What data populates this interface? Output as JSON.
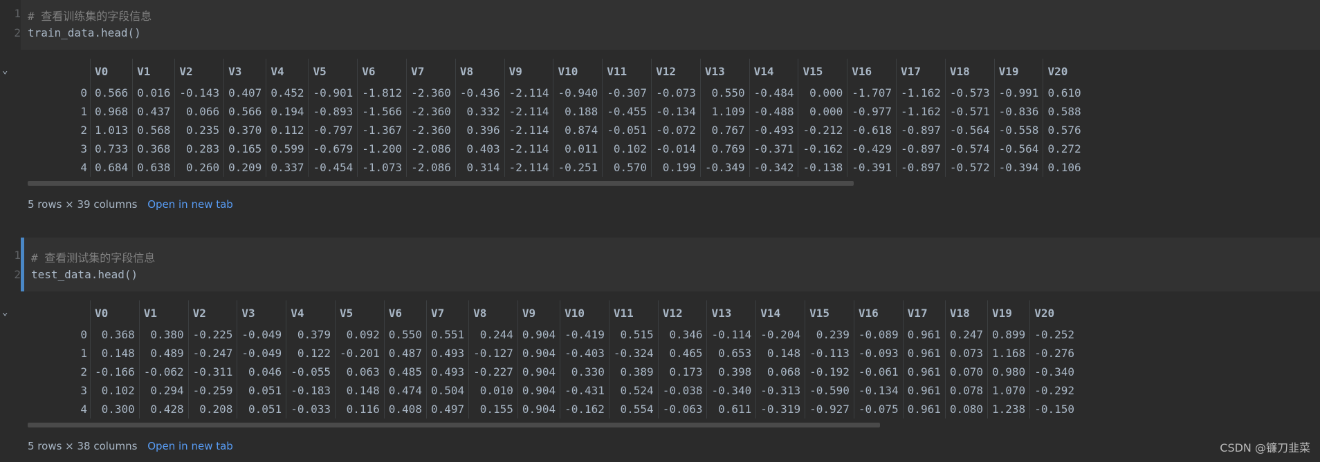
{
  "cells": [
    {
      "lines": [
        "# 查看训练集的字段信息",
        "train_data.head()"
      ],
      "footer": "5 rows × 39 columns",
      "link": "Open in new tab",
      "columns": [
        "V0",
        "V1",
        "V2",
        "V3",
        "V4",
        "V5",
        "V6",
        "V7",
        "V8",
        "V9",
        "V10",
        "V11",
        "V12",
        "V13",
        "V14",
        "V15",
        "V16",
        "V17",
        "V18",
        "V19",
        "V20"
      ],
      "rows": [
        {
          "idx": "0",
          "vals": [
            "0.566",
            "0.016",
            "-0.143",
            "0.407",
            "0.452",
            "-0.901",
            "-1.812",
            "-2.360",
            "-0.436",
            "-2.114",
            "-0.940",
            "-0.307",
            "-0.073",
            "0.550",
            "-0.484",
            "0.000",
            "-1.707",
            "-1.162",
            "-0.573",
            "-0.991",
            "0.610"
          ]
        },
        {
          "idx": "1",
          "vals": [
            "0.968",
            "0.437",
            "0.066",
            "0.566",
            "0.194",
            "-0.893",
            "-1.566",
            "-2.360",
            "0.332",
            "-2.114",
            "0.188",
            "-0.455",
            "-0.134",
            "1.109",
            "-0.488",
            "0.000",
            "-0.977",
            "-1.162",
            "-0.571",
            "-0.836",
            "0.588"
          ]
        },
        {
          "idx": "2",
          "vals": [
            "1.013",
            "0.568",
            "0.235",
            "0.370",
            "0.112",
            "-0.797",
            "-1.367",
            "-2.360",
            "0.396",
            "-2.114",
            "0.874",
            "-0.051",
            "-0.072",
            "0.767",
            "-0.493",
            "-0.212",
            "-0.618",
            "-0.897",
            "-0.564",
            "-0.558",
            "0.576"
          ]
        },
        {
          "idx": "3",
          "vals": [
            "0.733",
            "0.368",
            "0.283",
            "0.165",
            "0.599",
            "-0.679",
            "-1.200",
            "-2.086",
            "0.403",
            "-2.114",
            "0.011",
            "0.102",
            "-0.014",
            "0.769",
            "-0.371",
            "-0.162",
            "-0.429",
            "-0.897",
            "-0.574",
            "-0.564",
            "0.272"
          ]
        },
        {
          "idx": "4",
          "vals": [
            "0.684",
            "0.638",
            "0.260",
            "0.209",
            "0.337",
            "-0.454",
            "-1.073",
            "-2.086",
            "0.314",
            "-2.114",
            "-0.251",
            "0.570",
            "0.199",
            "-0.349",
            "-0.342",
            "-0.138",
            "-0.391",
            "-0.897",
            "-0.572",
            "-0.394",
            "0.106"
          ]
        }
      ]
    },
    {
      "lines": [
        "# 查看测试集的字段信息",
        "test_data.head()"
      ],
      "footer": "5 rows × 38 columns",
      "link": "Open in new tab",
      "columns": [
        "V0",
        "V1",
        "V2",
        "V3",
        "V4",
        "V5",
        "V6",
        "V7",
        "V8",
        "V9",
        "V10",
        "V11",
        "V12",
        "V13",
        "V14",
        "V15",
        "V16",
        "V17",
        "V18",
        "V19",
        "V20"
      ],
      "rows": [
        {
          "idx": "0",
          "vals": [
            "0.368",
            "0.380",
            "-0.225",
            "-0.049",
            "0.379",
            "0.092",
            "0.550",
            "0.551",
            "0.244",
            "0.904",
            "-0.419",
            "0.515",
            "0.346",
            "-0.114",
            "-0.204",
            "0.239",
            "-0.089",
            "0.961",
            "0.247",
            "0.899",
            "-0.252"
          ]
        },
        {
          "idx": "1",
          "vals": [
            "0.148",
            "0.489",
            "-0.247",
            "-0.049",
            "0.122",
            "-0.201",
            "0.487",
            "0.493",
            "-0.127",
            "0.904",
            "-0.403",
            "-0.324",
            "0.465",
            "0.653",
            "0.148",
            "-0.113",
            "-0.093",
            "0.961",
            "0.073",
            "1.168",
            "-0.276"
          ]
        },
        {
          "idx": "2",
          "vals": [
            "-0.166",
            "-0.062",
            "-0.311",
            "0.046",
            "-0.055",
            "0.063",
            "0.485",
            "0.493",
            "-0.227",
            "0.904",
            "0.330",
            "0.389",
            "0.173",
            "0.398",
            "0.068",
            "-0.192",
            "-0.061",
            "0.961",
            "0.070",
            "0.980",
            "-0.340"
          ]
        },
        {
          "idx": "3",
          "vals": [
            "0.102",
            "0.294",
            "-0.259",
            "0.051",
            "-0.183",
            "0.148",
            "0.474",
            "0.504",
            "0.010",
            "0.904",
            "-0.431",
            "0.524",
            "-0.038",
            "-0.340",
            "-0.313",
            "-0.590",
            "-0.134",
            "0.961",
            "0.078",
            "1.070",
            "-0.292"
          ]
        },
        {
          "idx": "4",
          "vals": [
            "0.300",
            "0.428",
            "0.208",
            "0.051",
            "-0.033",
            "0.116",
            "0.408",
            "0.497",
            "0.155",
            "0.904",
            "-0.162",
            "0.554",
            "-0.063",
            "0.611",
            "-0.319",
            "-0.927",
            "-0.075",
            "0.961",
            "0.080",
            "1.238",
            "-0.150"
          ]
        }
      ]
    }
  ],
  "line_numbers": [
    "1",
    "2"
  ],
  "watermark": "CSDN @镰刀韭菜",
  "colors": {
    "accent": "#4a88c7",
    "link": "#589df6"
  }
}
